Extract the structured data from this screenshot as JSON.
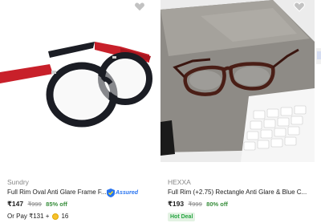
{
  "products": [
    {
      "brand": "Sundry",
      "title": "Full Rim Oval Anti Glare Frame F...",
      "price": "₹147",
      "mrp": "₹999",
      "discount": "85% off",
      "assured_label": "Assured",
      "or_pay": "Or Pay ₹131 +",
      "coins": "16",
      "frame_colors": {
        "rim": "#1b1d24",
        "temple": "#c8202a"
      }
    },
    {
      "brand": "HEXXA",
      "title": "Full Rim (+2.75) Rectangle Anti Glare & Blue C...",
      "price": "₹193",
      "mrp": "₹999",
      "discount": "80% off",
      "badge": "Hot Deal",
      "frame_colors": {
        "rim": "#4a1e16",
        "background": "#ececec"
      }
    }
  ],
  "colors": {
    "discount": "#388e3c",
    "assured": "#2874f0",
    "hot_deal": "#26a541"
  },
  "icons": {
    "wishlist": "heart-icon",
    "assured": "assured-badge-icon",
    "coin": "supercoin-icon"
  }
}
